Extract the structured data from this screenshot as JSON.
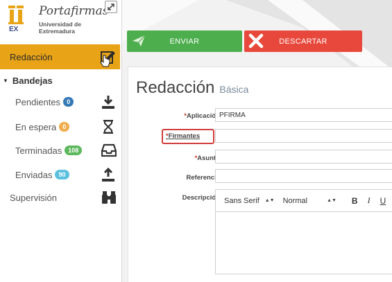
{
  "brand": {
    "title": "Portafirmas",
    "subtitle": "Universidad de Extremadura",
    "mark_letters": "EX"
  },
  "sidebar": {
    "active_item": {
      "label": "Redacción",
      "icon": "edit-icon"
    },
    "section": {
      "label": "Bandejas"
    },
    "items": [
      {
        "label": "Pendientes",
        "badge": "0",
        "badge_color": "#337ab7",
        "icon": "download-icon"
      },
      {
        "label": "En espera",
        "badge": "0",
        "badge_color": "#f0ad4e",
        "icon": "hourglass-icon"
      },
      {
        "label": "Terminadas",
        "badge": "108",
        "badge_color": "#5cb85c",
        "icon": "inbox-icon"
      },
      {
        "label": "Enviadas",
        "badge": "90",
        "badge_color": "#5bc0de",
        "icon": "upload-icon"
      }
    ],
    "supervision": {
      "label": "Supervisión",
      "icon": "binoculars-icon"
    }
  },
  "actions": {
    "send_label": "ENVIAR",
    "discard_label": "DESCARTAR",
    "send_color": "#4cae4c",
    "discard_color": "#e8483c"
  },
  "form": {
    "title": "Redacción",
    "subtitle": "Básica",
    "fields": {
      "aplicacion": {
        "label": "Aplicación",
        "required_mark": "*",
        "value": "PFIRMA"
      },
      "firmantes": {
        "label": "Firmantes",
        "required_mark": "*",
        "value": ""
      },
      "asunto": {
        "label": "Asunto",
        "required_mark": "*",
        "value": ""
      },
      "referencia": {
        "label": "Referencia",
        "value": ""
      },
      "descripcion": {
        "label": "Descripción"
      }
    },
    "editor": {
      "font": "Sans Serif",
      "size": "Normal",
      "bold": "B",
      "italic": "I",
      "underline": "U"
    }
  }
}
